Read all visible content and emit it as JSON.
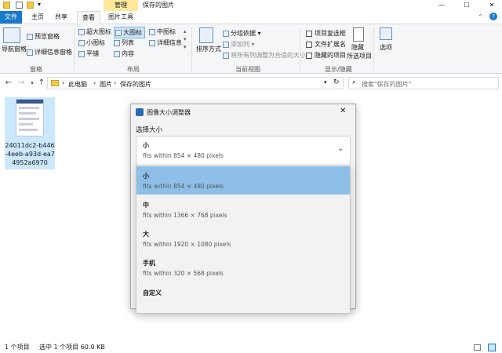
{
  "window": {
    "title": "保存的图片",
    "context_tab": "管理",
    "controls": [
      "—",
      "☐",
      "✕"
    ]
  },
  "ribbon_tabs": [
    "文件",
    "主页",
    "共享",
    "查看",
    "图片工具"
  ],
  "ribbon": {
    "pane_group": {
      "nav_pane": "导航窗格",
      "preview": "预览窗格",
      "details": "详细信息窗格",
      "label": "窗格"
    },
    "layout_group": {
      "items": [
        "超大图标",
        "大图标",
        "中图标",
        "小图标",
        "列表",
        "详细信息",
        "平铺",
        "内容"
      ],
      "label": "布局"
    },
    "view_group": {
      "sort": "排序方式",
      "group_by": "分组依据",
      "add_column": "添加列",
      "fit_columns": "将所有列调整为合适的大小",
      "label": "当前视图"
    },
    "showhide_group": {
      "checkbox1": "项目复选框",
      "checkbox2": "文件扩展名",
      "checkbox3": "隐藏的项目",
      "hide_selected": "隐藏",
      "hide_selected2": "所选项目",
      "label": "显示/隐藏"
    },
    "options": "选项"
  },
  "address": {
    "path": [
      "此电脑",
      "图片",
      "保存的图片"
    ],
    "search_placeholder": "搜索\"保存的图片\""
  },
  "file": {
    "name": "24011dc2-b446-4eeb-a93d-ea74952a6970"
  },
  "status": {
    "count": "1 个项目",
    "selected": "选中 1 个项目 60.0 KB"
  },
  "dialog": {
    "title": "图像大小调整器",
    "label": "选择大小",
    "selected_title": "小",
    "selected_desc": "fits within 854 × 480 pixels",
    "options": [
      {
        "title": "小",
        "desc": "fits within 854 × 480 pixels"
      },
      {
        "title": "中",
        "desc": "fits within 1366 × 768 pixels"
      },
      {
        "title": "大",
        "desc": "fits within 1920 × 1080 pixels"
      },
      {
        "title": "手机",
        "desc": "fits within 320 × 568 pixels"
      },
      {
        "title": "自定义",
        "desc": ""
      }
    ]
  },
  "colors": {
    "accent": "#1979ca",
    "selected_option": "#8dbfe8",
    "file_selected": "#cce8ff"
  }
}
